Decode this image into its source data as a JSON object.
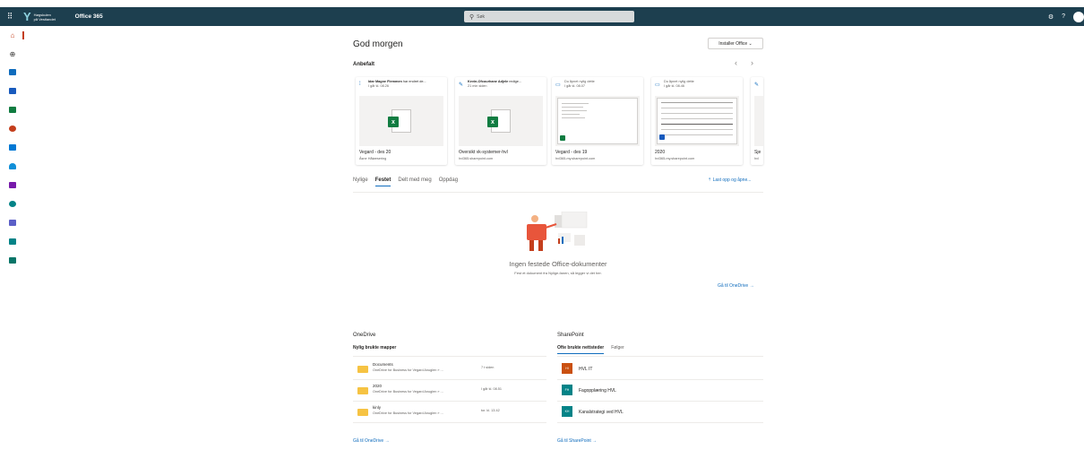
{
  "header": {
    "org_line1": "Høgskulen",
    "org_line2": "på Vestlandet",
    "app_title": "Office 365",
    "search_placeholder": "Søk"
  },
  "greeting": "God morgen",
  "install_button": "Installer Office ⌄",
  "recommended": {
    "title": "Anbefalt",
    "cards": [
      {
        "person": "Idar Magne Flemmen",
        "action": "har endret de...",
        "time": "I går kl. 08.26",
        "name": "Vegard - des 20",
        "location": "Åsne Håløesering"
      },
      {
        "person": "Kevin-Ofcourhane Adjele",
        "action": "redige...",
        "time": "21 min siden",
        "name": "Oversikt vk-systemer-hvl",
        "location": "hvl365.sharepoint.com"
      },
      {
        "person": "",
        "action": "Du åpnet nylig dette",
        "time": "I går kl. 08.07",
        "name": "Vegard - des 19",
        "location": "hvl365-my.sharepoint.com"
      },
      {
        "person": "",
        "action": "Du åpnet nylig dette",
        "time": "I går kl. 08.46",
        "name": "2020",
        "location": "hvl365-my.sharepoint.com"
      },
      {
        "person": "",
        "action": "",
        "time": "",
        "name": "Sje",
        "location": "hvl"
      }
    ]
  },
  "tabs": [
    "Nylige",
    "Festet",
    "Delt med meg",
    "Oppdag"
  ],
  "active_tab": "Festet",
  "upload_label": "Last opp og åpne...",
  "empty_state": {
    "title": "Ingen festede Office-dokumenter",
    "subtitle": "Fest et dokument fra Nylige-fanen, så legger vi det her.",
    "link": "Gå til OneDrive →"
  },
  "onedrive": {
    "title": "OneDrive",
    "subtitle": "Nylig brukte mapper",
    "folders": [
      {
        "name": "Documents",
        "path": "OneDrive for Business for Vegard Anuglen » ...",
        "time": "7 t siden"
      },
      {
        "name": "2020",
        "path": "OneDrive for Business for Vegard Anuglen » ...",
        "time": "I går kl. 08.51"
      },
      {
        "name": "kinly",
        "path": "OneDrive for Business for Vegard Anuglen » ...",
        "time": "tor. kl. 13.42"
      }
    ],
    "link": "Gå til OneDrive →"
  },
  "sharepoint": {
    "title": "SharePoint",
    "tabs": [
      "Ofte brukte nettsteder",
      "Følger"
    ],
    "sites": [
      {
        "abbr": "HI",
        "name": "HVL IT",
        "color": "#ca5010"
      },
      {
        "abbr": "FH",
        "name": "Fagopplæring HVL",
        "color": "#038387"
      },
      {
        "abbr": "KH",
        "name": "Kanalstrategi ved HVL",
        "color": "#038387"
      }
    ],
    "link": "Gå til SharePoint →"
  }
}
